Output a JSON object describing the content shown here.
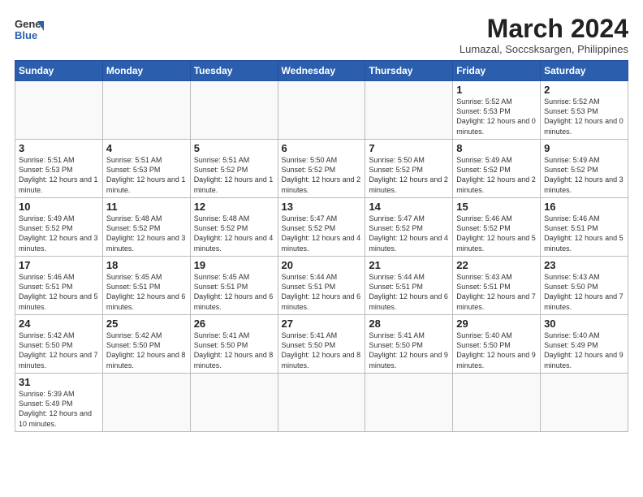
{
  "header": {
    "logo_line1": "General",
    "logo_line2": "Blue",
    "month_title": "March 2024",
    "subtitle": "Lumazal, Soccsksargen, Philippines"
  },
  "weekdays": [
    "Sunday",
    "Monday",
    "Tuesday",
    "Wednesday",
    "Thursday",
    "Friday",
    "Saturday"
  ],
  "weeks": [
    [
      {
        "day": "",
        "info": ""
      },
      {
        "day": "",
        "info": ""
      },
      {
        "day": "",
        "info": ""
      },
      {
        "day": "",
        "info": ""
      },
      {
        "day": "",
        "info": ""
      },
      {
        "day": "1",
        "info": "Sunrise: 5:52 AM\nSunset: 5:53 PM\nDaylight: 12 hours\nand 0 minutes."
      },
      {
        "day": "2",
        "info": "Sunrise: 5:52 AM\nSunset: 5:53 PM\nDaylight: 12 hours\nand 0 minutes."
      }
    ],
    [
      {
        "day": "3",
        "info": "Sunrise: 5:51 AM\nSunset: 5:53 PM\nDaylight: 12 hours\nand 1 minute."
      },
      {
        "day": "4",
        "info": "Sunrise: 5:51 AM\nSunset: 5:53 PM\nDaylight: 12 hours\nand 1 minute."
      },
      {
        "day": "5",
        "info": "Sunrise: 5:51 AM\nSunset: 5:52 PM\nDaylight: 12 hours\nand 1 minute."
      },
      {
        "day": "6",
        "info": "Sunrise: 5:50 AM\nSunset: 5:52 PM\nDaylight: 12 hours\nand 2 minutes."
      },
      {
        "day": "7",
        "info": "Sunrise: 5:50 AM\nSunset: 5:52 PM\nDaylight: 12 hours\nand 2 minutes."
      },
      {
        "day": "8",
        "info": "Sunrise: 5:49 AM\nSunset: 5:52 PM\nDaylight: 12 hours\nand 2 minutes."
      },
      {
        "day": "9",
        "info": "Sunrise: 5:49 AM\nSunset: 5:52 PM\nDaylight: 12 hours\nand 3 minutes."
      }
    ],
    [
      {
        "day": "10",
        "info": "Sunrise: 5:49 AM\nSunset: 5:52 PM\nDaylight: 12 hours\nand 3 minutes."
      },
      {
        "day": "11",
        "info": "Sunrise: 5:48 AM\nSunset: 5:52 PM\nDaylight: 12 hours\nand 3 minutes."
      },
      {
        "day": "12",
        "info": "Sunrise: 5:48 AM\nSunset: 5:52 PM\nDaylight: 12 hours\nand 4 minutes."
      },
      {
        "day": "13",
        "info": "Sunrise: 5:47 AM\nSunset: 5:52 PM\nDaylight: 12 hours\nand 4 minutes."
      },
      {
        "day": "14",
        "info": "Sunrise: 5:47 AM\nSunset: 5:52 PM\nDaylight: 12 hours\nand 4 minutes."
      },
      {
        "day": "15",
        "info": "Sunrise: 5:46 AM\nSunset: 5:52 PM\nDaylight: 12 hours\nand 5 minutes."
      },
      {
        "day": "16",
        "info": "Sunrise: 5:46 AM\nSunset: 5:51 PM\nDaylight: 12 hours\nand 5 minutes."
      }
    ],
    [
      {
        "day": "17",
        "info": "Sunrise: 5:46 AM\nSunset: 5:51 PM\nDaylight: 12 hours\nand 5 minutes."
      },
      {
        "day": "18",
        "info": "Sunrise: 5:45 AM\nSunset: 5:51 PM\nDaylight: 12 hours\nand 6 minutes."
      },
      {
        "day": "19",
        "info": "Sunrise: 5:45 AM\nSunset: 5:51 PM\nDaylight: 12 hours\nand 6 minutes."
      },
      {
        "day": "20",
        "info": "Sunrise: 5:44 AM\nSunset: 5:51 PM\nDaylight: 12 hours\nand 6 minutes."
      },
      {
        "day": "21",
        "info": "Sunrise: 5:44 AM\nSunset: 5:51 PM\nDaylight: 12 hours\nand 6 minutes."
      },
      {
        "day": "22",
        "info": "Sunrise: 5:43 AM\nSunset: 5:51 PM\nDaylight: 12 hours\nand 7 minutes."
      },
      {
        "day": "23",
        "info": "Sunrise: 5:43 AM\nSunset: 5:50 PM\nDaylight: 12 hours\nand 7 minutes."
      }
    ],
    [
      {
        "day": "24",
        "info": "Sunrise: 5:42 AM\nSunset: 5:50 PM\nDaylight: 12 hours\nand 7 minutes."
      },
      {
        "day": "25",
        "info": "Sunrise: 5:42 AM\nSunset: 5:50 PM\nDaylight: 12 hours\nand 8 minutes."
      },
      {
        "day": "26",
        "info": "Sunrise: 5:41 AM\nSunset: 5:50 PM\nDaylight: 12 hours\nand 8 minutes."
      },
      {
        "day": "27",
        "info": "Sunrise: 5:41 AM\nSunset: 5:50 PM\nDaylight: 12 hours\nand 8 minutes."
      },
      {
        "day": "28",
        "info": "Sunrise: 5:41 AM\nSunset: 5:50 PM\nDaylight: 12 hours\nand 9 minutes."
      },
      {
        "day": "29",
        "info": "Sunrise: 5:40 AM\nSunset: 5:50 PM\nDaylight: 12 hours\nand 9 minutes."
      },
      {
        "day": "30",
        "info": "Sunrise: 5:40 AM\nSunset: 5:49 PM\nDaylight: 12 hours\nand 9 minutes."
      }
    ],
    [
      {
        "day": "31",
        "info": "Sunrise: 5:39 AM\nSunset: 5:49 PM\nDaylight: 12 hours\nand 10 minutes."
      },
      {
        "day": "",
        "info": ""
      },
      {
        "day": "",
        "info": ""
      },
      {
        "day": "",
        "info": ""
      },
      {
        "day": "",
        "info": ""
      },
      {
        "day": "",
        "info": ""
      },
      {
        "day": "",
        "info": ""
      }
    ]
  ]
}
